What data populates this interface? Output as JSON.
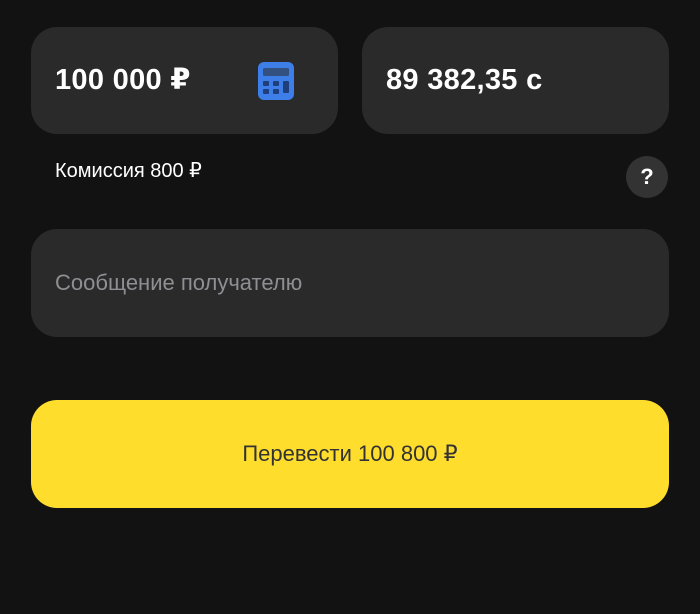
{
  "colors": {
    "background": "#121212",
    "card": "#2a2a2a",
    "accent_yellow": "#ffdd2d",
    "calculator_blue": "#3d7ee8",
    "placeholder": "#8e8e93"
  },
  "amount": {
    "value": "100 000 ₽",
    "icon": "calculator-icon"
  },
  "converted": {
    "value": "89 382,35 с"
  },
  "commission": {
    "text": "Комиссия 800 ₽"
  },
  "help": {
    "label": "?",
    "icon": "question-mark-icon"
  },
  "message": {
    "placeholder": "Сообщение получателю",
    "value": ""
  },
  "transfer": {
    "label": "Перевести 100 800 ₽"
  }
}
